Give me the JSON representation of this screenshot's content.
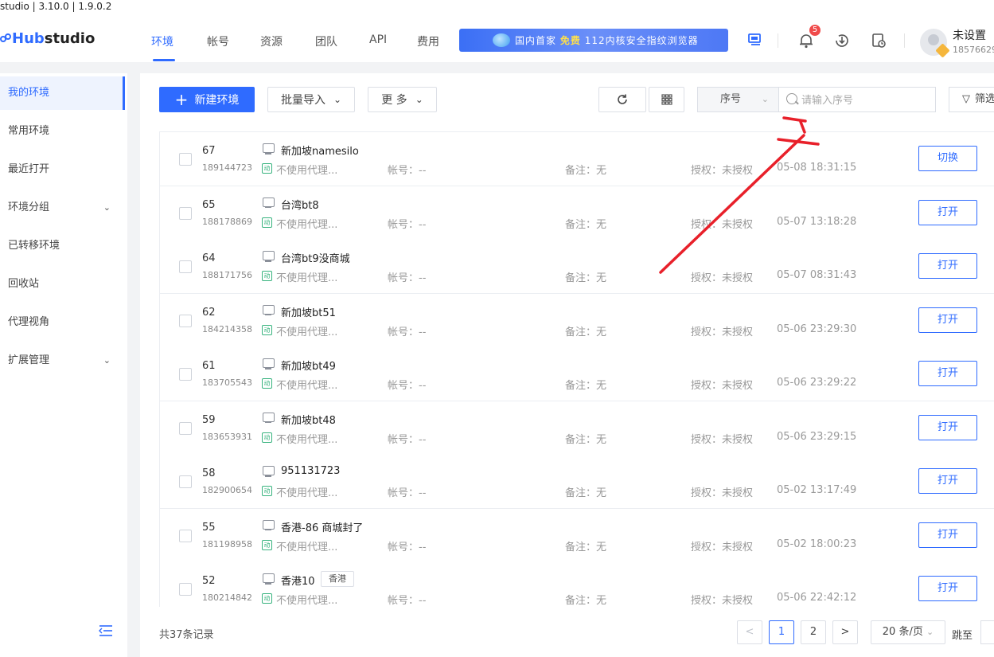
{
  "titlebar": {
    "text": "studio | 3.10.0 | 1.9.0.2"
  },
  "brand": {
    "logo_hub": "Hub",
    "logo_studio": "studio",
    "accent": "#2f6bff"
  },
  "nav": {
    "tabs": [
      "环境",
      "帐号",
      "资源",
      "团队",
      "API",
      "费用"
    ],
    "active": "环境"
  },
  "banner": {
    "prefix": "国内首家",
    "free": "免费",
    "suffix": "112内核安全指纹浏览器"
  },
  "header": {
    "notification_count": "5",
    "user_name": "未设置",
    "user_phone": "18576629",
    "icons": [
      "env-sync-icon",
      "bell-icon",
      "download-icon",
      "history-icon"
    ]
  },
  "sidebar": {
    "items": [
      {
        "label": "我的环境",
        "active": true,
        "expandable": false
      },
      {
        "label": "常用环境",
        "active": false,
        "expandable": false
      },
      {
        "label": "最近打开",
        "active": false,
        "expandable": false
      },
      {
        "label": "环境分组",
        "active": false,
        "expandable": true
      },
      {
        "label": "已转移环境",
        "active": false,
        "expandable": false
      },
      {
        "label": "回收站",
        "active": false,
        "expandable": false
      },
      {
        "label": "代理视角",
        "active": false,
        "expandable": false
      },
      {
        "label": "扩展管理",
        "active": false,
        "expandable": true
      }
    ]
  },
  "toolbar": {
    "new_env": "新建环境",
    "batch_import": "批量导入",
    "more": "更 多",
    "search_field": "序号",
    "search_placeholder": "请输入序号",
    "filter": "筛选"
  },
  "list": {
    "proxy_text": "不使用代理...",
    "account_label": "帐号：--",
    "note_label": "备注：无",
    "auth_label": "授权：未授权",
    "rows": [
      {
        "seq": "67",
        "id": "189144723",
        "name": "新加坡namesilo",
        "tag": "",
        "time": "05-08 18:31:15",
        "action": "切换"
      },
      {
        "seq": "65",
        "id": "188178869",
        "name": "台湾bt8",
        "tag": "",
        "time": "05-07 13:18:28",
        "action": "打开"
      },
      {
        "seq": "64",
        "id": "188171756",
        "name": "台湾bt9没商城",
        "tag": "",
        "time": "05-07 08:31:43",
        "action": "打开"
      },
      {
        "seq": "62",
        "id": "184214358",
        "name": "新加坡bt51",
        "tag": "",
        "time": "05-06 23:29:30",
        "action": "打开"
      },
      {
        "seq": "61",
        "id": "183705543",
        "name": "新加坡bt49",
        "tag": "",
        "time": "05-06 23:29:22",
        "action": "打开"
      },
      {
        "seq": "59",
        "id": "183653931",
        "name": "新加坡bt48",
        "tag": "",
        "time": "05-06 23:29:15",
        "action": "打开"
      },
      {
        "seq": "58",
        "id": "182900654",
        "name": "951131723",
        "tag": "",
        "time": "05-02 13:17:49",
        "action": "打开"
      },
      {
        "seq": "55",
        "id": "181198958",
        "name": "香港-86 商城封了",
        "tag": "",
        "time": "05-02 18:00:23",
        "action": "打开"
      },
      {
        "seq": "52",
        "id": "180214842",
        "name": "香港10",
        "tag": "香港",
        "time": "05-06 22:42:12",
        "action": "打开"
      }
    ]
  },
  "pagination": {
    "total": "共37条记录",
    "pages": [
      "1",
      "2"
    ],
    "current": "1",
    "page_size": "20 条/页",
    "jump_label": "跳至"
  },
  "annotation": {
    "color": "#e8202a"
  }
}
